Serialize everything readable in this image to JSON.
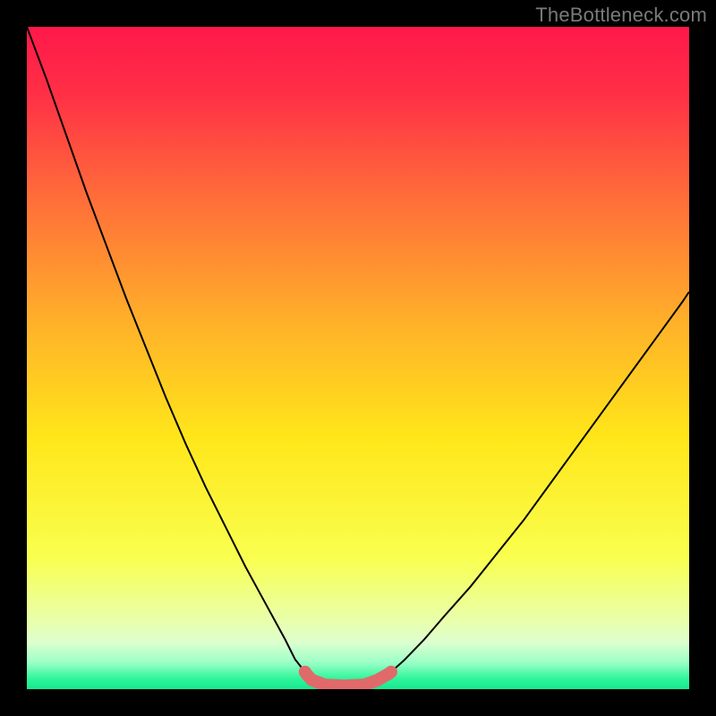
{
  "watermark": "TheBottleneck.com",
  "chart_data": {
    "type": "line",
    "title": "",
    "xlabel": "",
    "ylabel": "",
    "xlim": [
      0,
      100
    ],
    "ylim": [
      0,
      100
    ],
    "grid": false,
    "legend": false,
    "background_gradient_stops": [
      {
        "offset": 0.0,
        "color": "#ff184a"
      },
      {
        "offset": 0.1,
        "color": "#ff2f46"
      },
      {
        "offset": 0.25,
        "color": "#ff6a3a"
      },
      {
        "offset": 0.45,
        "color": "#ffb229"
      },
      {
        "offset": 0.62,
        "color": "#ffe61a"
      },
      {
        "offset": 0.8,
        "color": "#f9ff4e"
      },
      {
        "offset": 0.9,
        "color": "#e8ffae"
      },
      {
        "offset": 0.93,
        "color": "#dcffd0"
      },
      {
        "offset": 0.96,
        "color": "#9affc6"
      },
      {
        "offset": 0.985,
        "color": "#2cf59a"
      },
      {
        "offset": 1.0,
        "color": "#18e88e"
      }
    ],
    "series": [
      {
        "name": "curve-left",
        "color": "#000000",
        "stroke_width": 2,
        "x": [
          0,
          3,
          6,
          9,
          12,
          15,
          18,
          21,
          24,
          27,
          30,
          33,
          36,
          39,
          40.5,
          42
        ],
        "y": [
          100,
          92,
          83.5,
          75,
          67,
          59,
          51.5,
          44,
          37,
          30.5,
          24.5,
          18.5,
          13,
          7.5,
          4.5,
          2.6
        ]
      },
      {
        "name": "curve-right",
        "color": "#000000",
        "stroke_width": 2,
        "x": [
          55,
          57,
          60,
          63,
          67,
          71,
          75,
          79,
          83,
          87,
          91,
          95,
          99,
          100
        ],
        "y": [
          2.6,
          4.4,
          7.5,
          11,
          15.5,
          20.5,
          25.5,
          31,
          36.5,
          42,
          47.5,
          53,
          58.5,
          60
        ]
      },
      {
        "name": "bottom-highlight",
        "color": "#e06a6a",
        "stroke_width": 14,
        "linecap": "round",
        "x": [
          42,
          42.2,
          43,
          45,
          48,
          51,
          53,
          54.6,
          55
        ],
        "y": [
          2.6,
          2.3,
          1.4,
          0.65,
          0.5,
          0.65,
          1.4,
          2.3,
          2.6
        ]
      }
    ]
  }
}
